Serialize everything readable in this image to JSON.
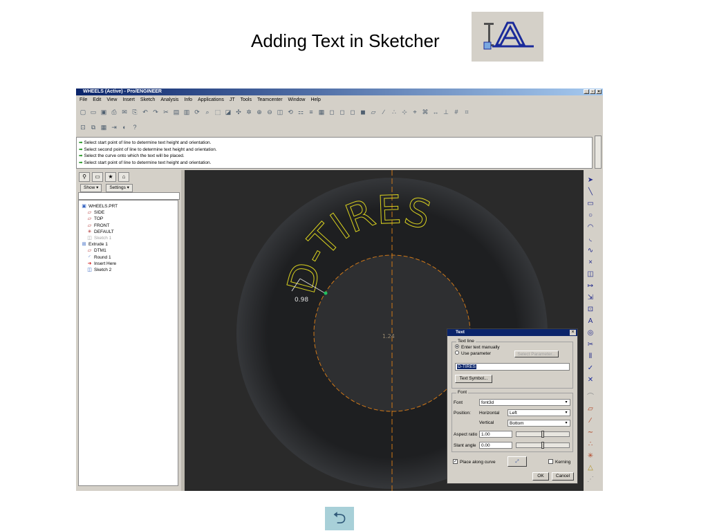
{
  "slide": {
    "title": "Adding Text in Sketcher",
    "title_icon": "text-sketch-icon"
  },
  "window": {
    "title": "WHEELS (Active) - Pro/ENGINEER",
    "menu": [
      "File",
      "Edit",
      "View",
      "Insert",
      "Sketch",
      "Analysis",
      "Info",
      "Applications",
      "JT",
      "Tools",
      "Teamcenter",
      "Window",
      "Help"
    ]
  },
  "messages": [
    "Select start point of line to determine text height and orientation.",
    "Select second point of line to determine text height and orientation.",
    "Select the curve onto which the text will be placed.",
    "Select start point of line to determine text height and orientation."
  ],
  "nav": {
    "show_label": "Show ▾",
    "settings_label": "Settings ▾",
    "tree": [
      {
        "label": "WHEELS.PRT",
        "icon": "part-icon",
        "indent": 0
      },
      {
        "label": "SIDE",
        "icon": "datum-plane-icon",
        "indent": 1
      },
      {
        "label": "TOP",
        "icon": "datum-plane-icon",
        "indent": 1
      },
      {
        "label": "FRONT",
        "icon": "datum-plane-icon",
        "indent": 1
      },
      {
        "label": "DEFAULT",
        "icon": "coordinate-system-icon",
        "indent": 1
      },
      {
        "label": "Sketch 1",
        "icon": "sketch-icon",
        "indent": 1,
        "dimmed": true
      },
      {
        "label": "Extrude 1",
        "icon": "extrude-icon",
        "indent": 0,
        "expandable": true
      },
      {
        "label": "DTM1",
        "icon": "datum-plane-icon",
        "indent": 1
      },
      {
        "label": "Round 1",
        "icon": "round-icon",
        "indent": 1
      },
      {
        "label": "Insert Here",
        "icon": "insert-arrow-icon",
        "indent": 1
      },
      {
        "label": "Sketch 2",
        "icon": "sketch-icon",
        "indent": 1
      }
    ]
  },
  "graphics": {
    "curved_text": "D-TIRES",
    "dimension_label": "0.98",
    "center_label": "1.24",
    "colors": {
      "background": "#2a2a2a",
      "tire": "#1e1f21",
      "sketch": "#d8d020",
      "centerline": "#d07818"
    }
  },
  "dialog": {
    "title": "Text",
    "text_line_group": "Text line",
    "radio_manual": "Enter text manually",
    "radio_param": "Use parameter",
    "select_param_btn": "Select Parameter...",
    "text_value": "D-TIRES",
    "text_symbol_btn": "Text Symbol...",
    "font_group": "Font",
    "font_label": "Font",
    "font_value": "font3d",
    "position_label": "Position:",
    "horizontal_label": "Horizontal",
    "horizontal_value": "Left",
    "vertical_label": "Vertical",
    "vertical_value": "Bottom",
    "aspect_label": "Aspect ratio",
    "aspect_value": "1.00",
    "slant_label": "Slant angle",
    "slant_value": "0.00",
    "place_along_curve": "Place along curve",
    "kerning": "Kerning",
    "ok": "OK",
    "cancel": "Cancel"
  },
  "bottom_nav_icon": "return-arrow-icon"
}
